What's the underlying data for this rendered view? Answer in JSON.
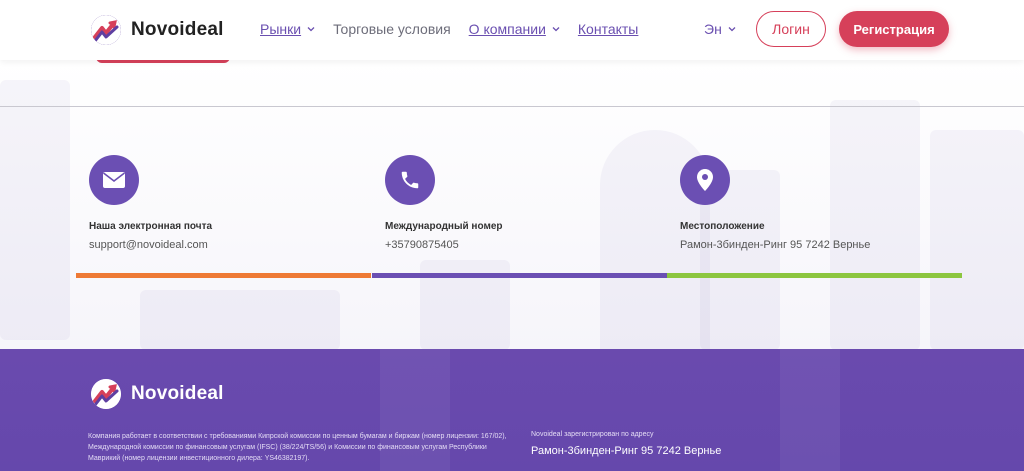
{
  "header": {
    "brand": "Novoideal",
    "nav": [
      {
        "label": "Рынки",
        "dropdown": true
      },
      {
        "label": "Торговые условия",
        "dropdown": false
      },
      {
        "label": "О компании",
        "dropdown": true
      },
      {
        "label": "Контакты",
        "dropdown": false
      }
    ],
    "language": "Эн",
    "login_label": "Логин",
    "register_label": "Регистрация"
  },
  "contacts": [
    {
      "icon": "envelope-icon",
      "label": "Наша электронная почта",
      "value": "support@novoideal.com",
      "bar_color": "#ee7a35"
    },
    {
      "icon": "phone-icon",
      "label": "Международный номер",
      "value": "+35790875405",
      "bar_color": "#6b4fb3"
    },
    {
      "icon": "location-pin-icon",
      "label": "Местоположение",
      "value": "Рамон-3бинден-Ринг 95 7242 Вернье",
      "bar_color": "#8cc63f"
    }
  ],
  "footer": {
    "brand": "Novoideal",
    "legal": "Компания работает в соответствии с требованиями Кипрской комиссии по ценным бумагам и биржам (номер лицензии: 167/02), Международной комиссии по финансовым услугам (IFSC) (38/224/TS/56) и Комиссии по финансовым услугам Республики Маврикий (номер лицензии инвестиционного дилера: YS46382197).",
    "registered_label": "Novoideal зарегистрирован по адресу",
    "registered_address": "Рамон-3бинден-Ринг 95 7242 Вернье"
  },
  "colors": {
    "accent_red": "#d6405a",
    "brand_purple": "#6b4fb3",
    "footer_purple": "#6a4aae"
  }
}
